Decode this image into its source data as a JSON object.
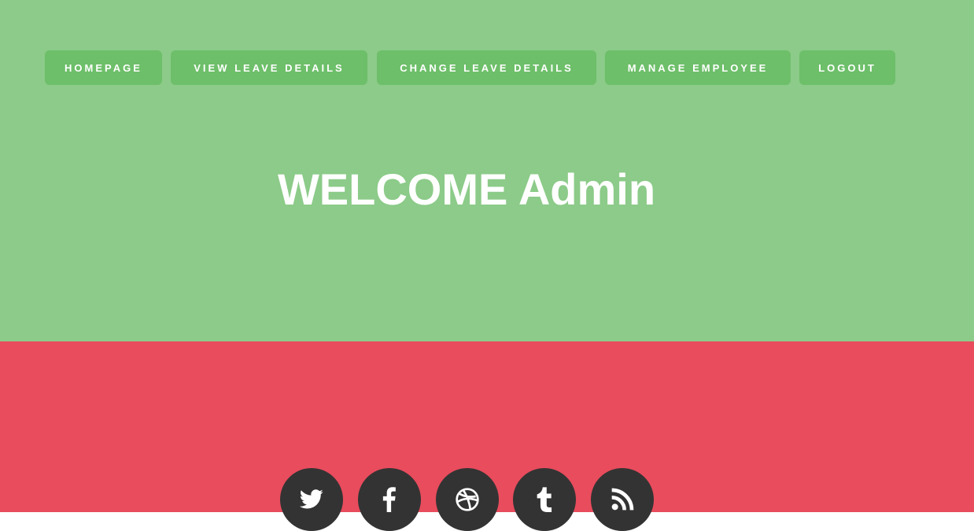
{
  "nav": {
    "items": [
      {
        "label": "HOMEPAGE"
      },
      {
        "label": "VIEW LEAVE DETAILS"
      },
      {
        "label": "CHANGE LEAVE DETAILS"
      },
      {
        "label": "MANAGE EMPLOYEE"
      },
      {
        "label": "LOGOUT"
      }
    ]
  },
  "hero": {
    "title": "WELCOME Admin"
  },
  "social": {
    "icons": [
      "twitter-icon",
      "facebook-icon",
      "dribbble-icon",
      "tumblr-icon",
      "rss-icon"
    ]
  },
  "colors": {
    "top_background": "#8ccb89",
    "nav_button": "#6dbf69",
    "bottom_background": "#e84c5d",
    "social_circle": "#333333",
    "text": "#ffffff"
  }
}
